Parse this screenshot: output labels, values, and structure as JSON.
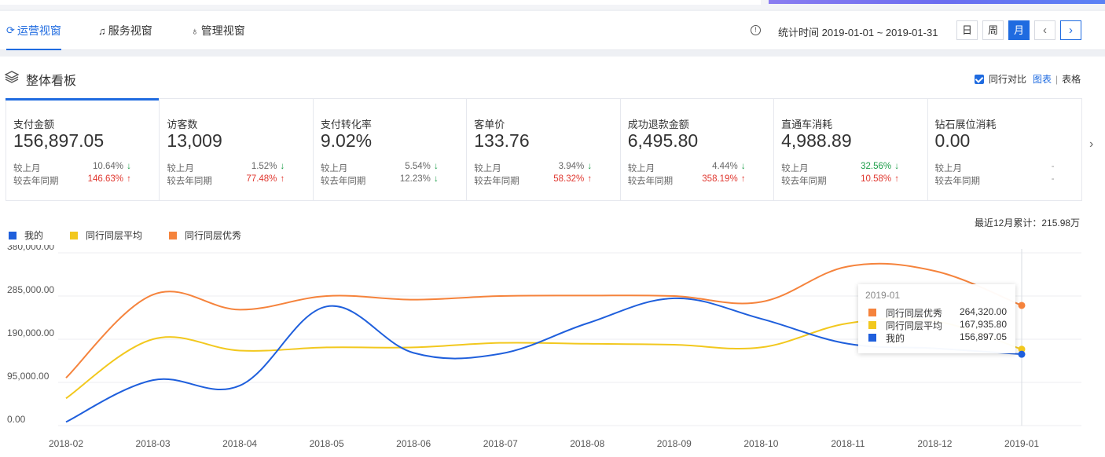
{
  "nav": {
    "tabs": [
      {
        "label": "运营视窗",
        "icon": "operations-icon"
      },
      {
        "label": "服务视窗",
        "icon": "headset-icon"
      },
      {
        "label": "管理视窗",
        "icon": "bag-icon"
      }
    ],
    "stat_time": "统计时间 2019-01-01 ~ 2019-01-31",
    "period_buttons": [
      "日",
      "周",
      "月"
    ],
    "prev": "‹",
    "next": "›"
  },
  "panel": {
    "title": "整体看板",
    "compare_label": "同行对比",
    "view_chart": "图表",
    "view_sep": "|",
    "view_table": "表格"
  },
  "metrics": [
    {
      "name": "支付金额",
      "value": "156,897.05",
      "r1_label": "较上月",
      "r1_val": "10.64%",
      "r1_dir": "down",
      "r2_label": "较去年同期",
      "r2_val": "146.63%",
      "r2_dir": "up"
    },
    {
      "name": "访客数",
      "value": "13,009",
      "r1_label": "较上月",
      "r1_val": "1.52%",
      "r1_dir": "down",
      "r2_label": "较去年同期",
      "r2_val": "77.48%",
      "r2_dir": "up"
    },
    {
      "name": "支付转化率",
      "value": "9.02%",
      "r1_label": "较上月",
      "r1_val": "5.54%",
      "r1_dir": "down",
      "r2_label": "较去年同期",
      "r2_val": "12.23%",
      "r2_dir": "down"
    },
    {
      "name": "客单价",
      "value": "133.76",
      "r1_label": "较上月",
      "r1_val": "3.94%",
      "r1_dir": "down",
      "r2_label": "较去年同期",
      "r2_val": "58.32%",
      "r2_dir": "up"
    },
    {
      "name": "成功退款金额",
      "value": "6,495.80",
      "r1_label": "较上月",
      "r1_val": "4.44%",
      "r1_dir": "down",
      "r2_label": "较去年同期",
      "r2_val": "358.19%",
      "r2_dir": "up"
    },
    {
      "name": "直通车消耗",
      "value": "4,988.89",
      "r1_label": "较上月",
      "r1_val": "32.56%",
      "r1_dir": "down",
      "r1_color": "green",
      "r2_label": "较去年同期",
      "r2_val": "10.58%",
      "r2_dir": "up"
    },
    {
      "name": "钻石展位消耗",
      "value": "0.00",
      "r1_label": "较上月",
      "r1_val": "-",
      "r1_dir": "none",
      "r2_label": "较去年同期",
      "r2_val": "-",
      "r2_dir": "none"
    }
  ],
  "card_next": "›",
  "summary": "最近12月累计：215.98万",
  "colors": {
    "accent": "#1f6be0",
    "mine": "#1f5fdc",
    "avg": "#f2c81e",
    "top": "#f5833c",
    "up": "#e0372f",
    "down": "#1e9e4a"
  },
  "legend": [
    {
      "label": "我的",
      "color": "#1f5fdc"
    },
    {
      "label": "同行同层平均",
      "color": "#f2c81e"
    },
    {
      "label": "同行同层优秀",
      "color": "#f5833c"
    }
  ],
  "tooltip": {
    "date": "2019-01",
    "rows": [
      {
        "name": "同行同层优秀",
        "value": "264,320.00",
        "color": "#f5833c"
      },
      {
        "name": "同行同层平均",
        "value": "167,935.80",
        "color": "#f2c81e"
      },
      {
        "name": "我的",
        "value": "156,897.05",
        "color": "#1f5fdc"
      }
    ]
  },
  "chart_data": {
    "type": "line",
    "x": [
      "2018-02",
      "2018-03",
      "2018-04",
      "2018-05",
      "2018-06",
      "2018-07",
      "2018-08",
      "2018-09",
      "2018-10",
      "2018-11",
      "2018-12",
      "2019-01"
    ],
    "y_ticks": [
      "380,000.00",
      "285,000.00",
      "190,000.00",
      "95,000.00",
      "0.00"
    ],
    "ylim": [
      0,
      380000
    ],
    "grid": true,
    "legend_position": "top-left",
    "series": [
      {
        "name": "我的",
        "color": "#1f5fdc",
        "values": [
          8000,
          100000,
          88000,
          262000,
          160000,
          158000,
          225000,
          280000,
          235000,
          180000,
          170000,
          156897
        ]
      },
      {
        "name": "同行同层平均",
        "color": "#f2c81e",
        "values": [
          60000,
          190000,
          165000,
          172000,
          172000,
          182000,
          180000,
          178000,
          172000,
          225000,
          230000,
          167936
        ]
      },
      {
        "name": "同行同层优秀",
        "color": "#f5833c",
        "values": [
          105000,
          288000,
          255000,
          285000,
          277000,
          285000,
          286000,
          285000,
          272000,
          350000,
          340000,
          264320
        ]
      }
    ]
  }
}
